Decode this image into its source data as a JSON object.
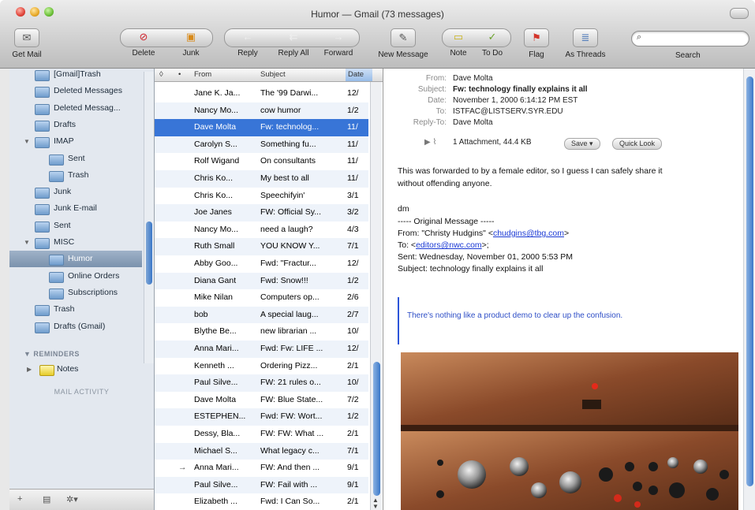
{
  "window": {
    "title": "Humor — Gmail (73 messages)"
  },
  "toolbar": {
    "get_mail": "Get Mail",
    "delete": "Delete",
    "junk": "Junk",
    "reply": "Reply",
    "reply_all": "Reply All",
    "forward": "Forward",
    "new_message": "New Message",
    "note": "Note",
    "to_do": "To Do",
    "flag": "Flag",
    "as_threads": "As Threads",
    "search_label": "Search",
    "search_placeholder": ""
  },
  "sidebar": {
    "items": [
      {
        "label": "[Gmail]Trash",
        "indent": 1
      },
      {
        "label": "Deleted Messages",
        "indent": 1
      },
      {
        "label": "Deleted Messag...",
        "indent": 1
      },
      {
        "label": "Drafts",
        "indent": 1
      },
      {
        "label": "IMAP",
        "indent": 1,
        "expanded": true
      },
      {
        "label": "Sent",
        "indent": 2
      },
      {
        "label": "Trash",
        "indent": 2
      },
      {
        "label": "Junk",
        "indent": 1
      },
      {
        "label": "Junk E-mail",
        "indent": 1
      },
      {
        "label": "Sent",
        "indent": 1
      },
      {
        "label": "MISC",
        "indent": 1,
        "expanded": true
      },
      {
        "label": "Humor",
        "indent": 2,
        "selected": true
      },
      {
        "label": "Online Orders",
        "indent": 2
      },
      {
        "label": "Subscriptions",
        "indent": 2
      },
      {
        "label": "Trash",
        "indent": 1
      },
      {
        "label": "Drafts (Gmail)",
        "indent": 1
      }
    ],
    "reminders_section": "REMINDERS",
    "notes": "Notes",
    "mail_activity": "MAIL ACTIVITY"
  },
  "list": {
    "columns": {
      "from": "From",
      "subject": "Subject",
      "date": "Date"
    },
    "rows": [
      {
        "from": "Jane K. Ja...",
        "subject": "The '99 Darwi...",
        "date": "12/"
      },
      {
        "from": "Nancy Mo...",
        "subject": "cow humor",
        "date": "1/2"
      },
      {
        "from": "Dave Molta",
        "subject": "Fw: technolog...",
        "date": "11/",
        "selected": true
      },
      {
        "from": "Carolyn S...",
        "subject": "Something fu...",
        "date": "11/"
      },
      {
        "from": "Rolf Wigand",
        "subject": "On consultants",
        "date": "11/"
      },
      {
        "from": "Chris Ko...",
        "subject": "My best to all",
        "date": "11/"
      },
      {
        "from": "Chris Ko...",
        "subject": "Speechifyin'",
        "date": "3/1"
      },
      {
        "from": "Joe Janes",
        "subject": "FW: Official Sy...",
        "date": "3/2"
      },
      {
        "from": "Nancy Mo...",
        "subject": "need a laugh?",
        "date": "4/3"
      },
      {
        "from": "Ruth Small",
        "subject": "YOU KNOW Y...",
        "date": "7/1"
      },
      {
        "from": "Abby Goo...",
        "subject": "Fwd: \"Fractur...",
        "date": "12/"
      },
      {
        "from": "Diana Gant",
        "subject": "Fwd: Snow!!!",
        "date": "1/2"
      },
      {
        "from": "Mike Nilan",
        "subject": "Computers op...",
        "date": "2/6"
      },
      {
        "from": "bob",
        "subject": "A special laug...",
        "date": "2/7"
      },
      {
        "from": "Blythe Be...",
        "subject": "new librarian ...",
        "date": "10/"
      },
      {
        "from": "Anna Mari...",
        "subject": "Fwd: Fw: LIFE ...",
        "date": "12/"
      },
      {
        "from": "Kenneth ...",
        "subject": "Ordering Pizz...",
        "date": "2/1"
      },
      {
        "from": "Paul Silve...",
        "subject": "FW: 21 rules o...",
        "date": "10/"
      },
      {
        "from": "Dave Molta",
        "subject": "FW: Blue State...",
        "date": "7/2"
      },
      {
        "from": "ESTEPHEN...",
        "subject": "Fwd: FW: Wort...",
        "date": "1/2"
      },
      {
        "from": "Dessy, Bla...",
        "subject": "FW: FW: What ...",
        "date": "2/1"
      },
      {
        "from": "Michael S...",
        "subject": "What legacy c...",
        "date": "7/1"
      },
      {
        "from": "Anna Mari...",
        "subject": "FW: And then ...",
        "date": "9/1",
        "flag": "→"
      },
      {
        "from": "Paul Silve...",
        "subject": "FW: Fail with ...",
        "date": "9/1"
      },
      {
        "from": "Elizabeth ...",
        "subject": "Fwd: I Can So...",
        "date": "2/1"
      }
    ]
  },
  "message": {
    "from_label": "From:",
    "from": "Dave Molta",
    "subject_label": "Subject:",
    "subject": "Fw: technology finally explains it all",
    "date_label": "Date:",
    "date": "November 1, 2000 6:14:12 PM EST",
    "to_label": "To:",
    "to": "ISTFAC@LISTSERV.SYR.EDU",
    "reply_to_label": "Reply-To:",
    "reply_to": "Dave Molta",
    "attachment": "1 Attachment, 44.4 KB",
    "save_btn": "Save ▾",
    "quick_look_btn": "Quick Look",
    "body_line1": "This was forwarded to by a female editor, so I guess I can safely share it",
    "body_line2": "without offending anyone.",
    "signature": "dm",
    "orig_header": "----- Original Message -----",
    "orig_from_prefix": "From: \"Christy Hudgins\" <",
    "orig_from_email": "chudgins@tbg.com",
    "orig_from_suffix": ">",
    "orig_to_prefix": "To: <",
    "orig_to_email": "editors@nwc.com",
    "orig_to_suffix": ">;",
    "orig_sent": "Sent: Wednesday, November 01, 2000 5:53 PM",
    "orig_subject": "Subject: technology finally explains it all",
    "quote": "There's nothing like a product demo to clear up the confusion."
  }
}
